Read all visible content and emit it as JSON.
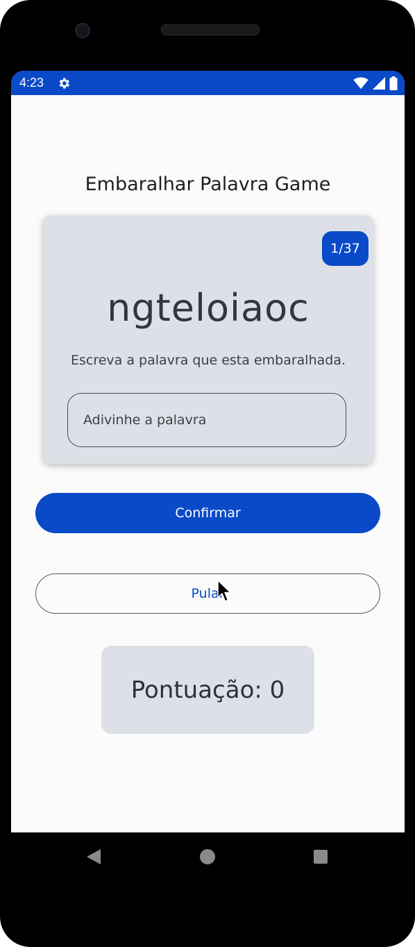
{
  "status_bar": {
    "time": "4:23",
    "background_color": "#0a4ac8",
    "icons": [
      "gear-icon",
      "wifi-icon",
      "signal-icon",
      "battery-icon"
    ]
  },
  "app": {
    "title": "Embaralhar Palavra Game",
    "word_count": "1/37",
    "scrambled_word": "ngteloiaoc",
    "instructions": "Escreva a palavra que esta embaralhada.",
    "guess_placeholder": "Adivinhe a palavra",
    "confirm_label": "Confirmar",
    "skip_label": "Pular",
    "score_text": "Pontuação: 0"
  },
  "colors": {
    "primary": "#0a4ac8",
    "card_background": "#dde1e7",
    "screen_background": "#fbfbfc"
  },
  "nav_bar": {
    "buttons": [
      "back-icon",
      "home-icon",
      "recents-icon"
    ]
  }
}
